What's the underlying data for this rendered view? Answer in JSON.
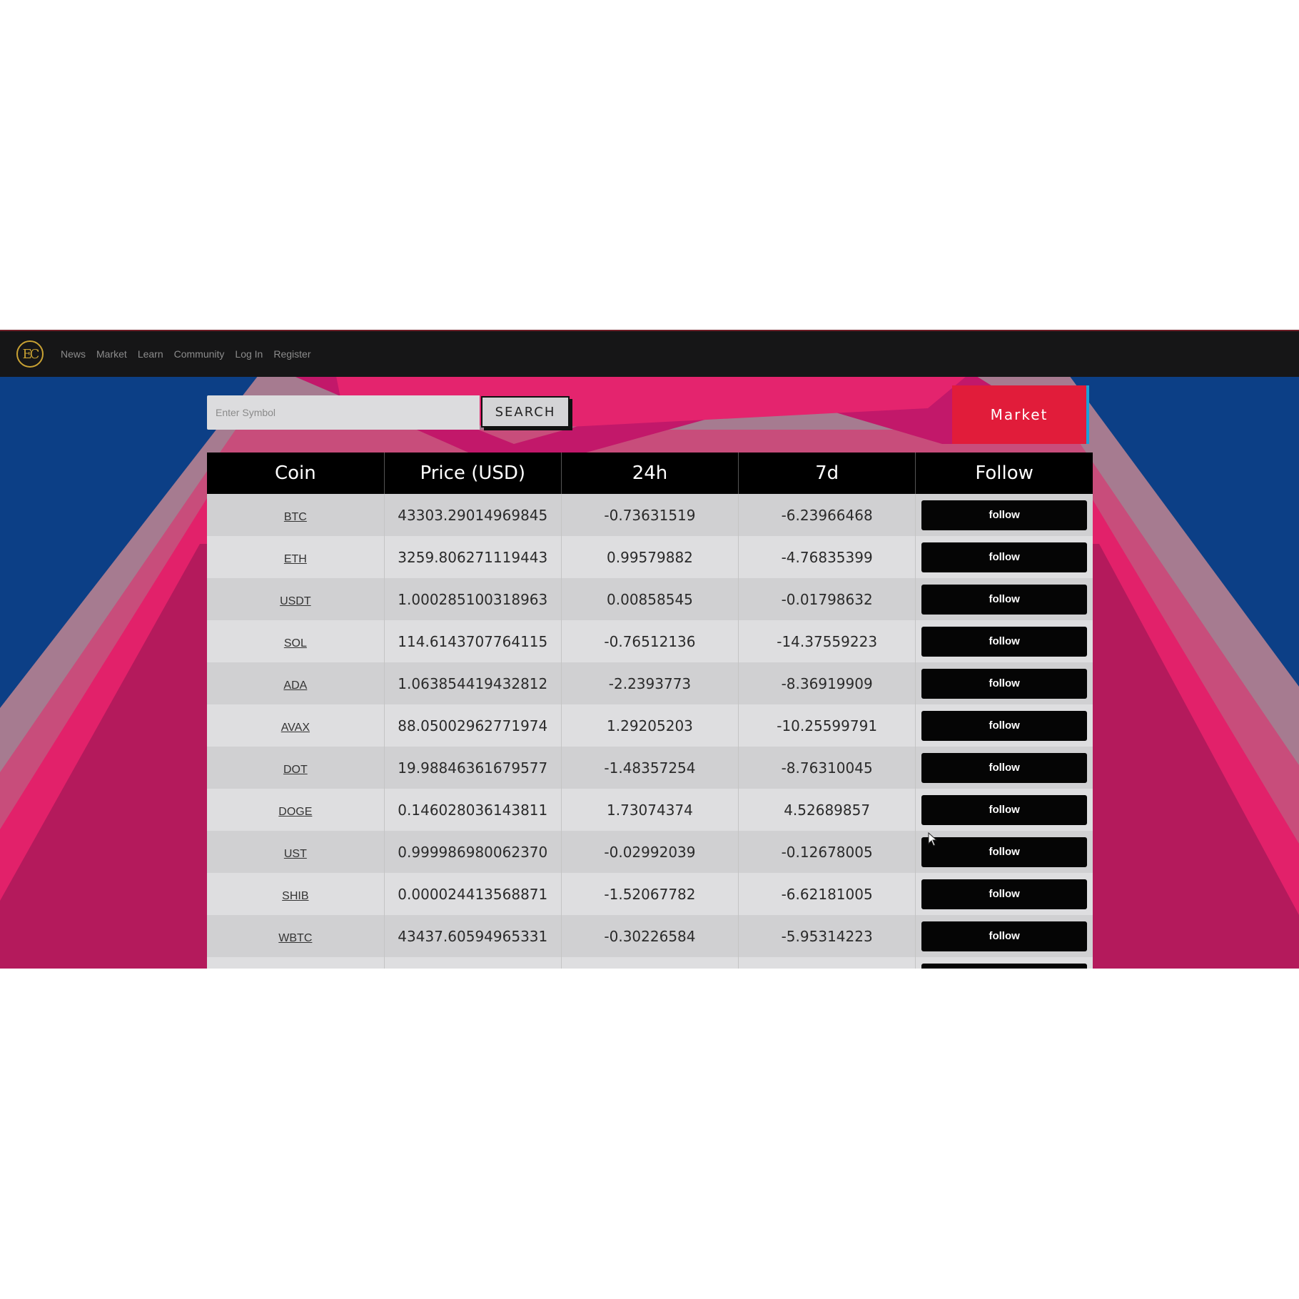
{
  "nav": {
    "logo_text": "EC",
    "links": [
      "News",
      "Market",
      "Learn",
      "Community",
      "Log In",
      "Register"
    ]
  },
  "search": {
    "placeholder": "Enter Symbol",
    "button_label": "SEARCH"
  },
  "market_button_label": "Market",
  "table": {
    "headers": [
      "Coin",
      "Price (USD)",
      "24h",
      "7d",
      "Follow"
    ],
    "follow_label": "follow",
    "rows": [
      {
        "coin": "BTC",
        "price": "43303.29014969845",
        "change_24h": "-0.73631519",
        "change_7d": "-6.23966468"
      },
      {
        "coin": "ETH",
        "price": "3259.806271119443",
        "change_24h": "0.99579882",
        "change_7d": "-4.76835399"
      },
      {
        "coin": "USDT",
        "price": "1.000285100318963",
        "change_24h": "0.00858545",
        "change_7d": "-0.01798632"
      },
      {
        "coin": "SOL",
        "price": "114.6143707764115",
        "change_24h": "-0.76512136",
        "change_7d": "-14.37559223"
      },
      {
        "coin": "ADA",
        "price": "1.063854419432812",
        "change_24h": "-2.2393773",
        "change_7d": "-8.36919909"
      },
      {
        "coin": "AVAX",
        "price": "88.05002962771974",
        "change_24h": "1.29205203",
        "change_7d": "-10.25599791"
      },
      {
        "coin": "DOT",
        "price": "19.98846361679577",
        "change_24h": "-1.48357254",
        "change_7d": "-8.76310045"
      },
      {
        "coin": "DOGE",
        "price": "0.146028036143811",
        "change_24h": "1.73074374",
        "change_7d": "4.52689857"
      },
      {
        "coin": "UST",
        "price": "0.999986980062370",
        "change_24h": "-0.02992039",
        "change_7d": "-0.12678005"
      },
      {
        "coin": "SHIB",
        "price": "0.000024413568871",
        "change_24h": "-1.52067782",
        "change_7d": "-6.62181005"
      },
      {
        "coin": "WBTC",
        "price": "43437.60594965331",
        "change_24h": "-0.30226584",
        "change_7d": "-5.95314223"
      },
      {
        "coin": "",
        "price": "",
        "change_24h": "",
        "change_7d": ""
      }
    ]
  },
  "colors": {
    "navbar": "#161617",
    "logo": "#c9a233",
    "market_button": "#e11c3a",
    "background_blue": "#0c3f86",
    "background_pink": "#e2216a",
    "table_header": "#000000"
  },
  "icons": [
    "logo-icon",
    "mouse-cursor-icon"
  ]
}
